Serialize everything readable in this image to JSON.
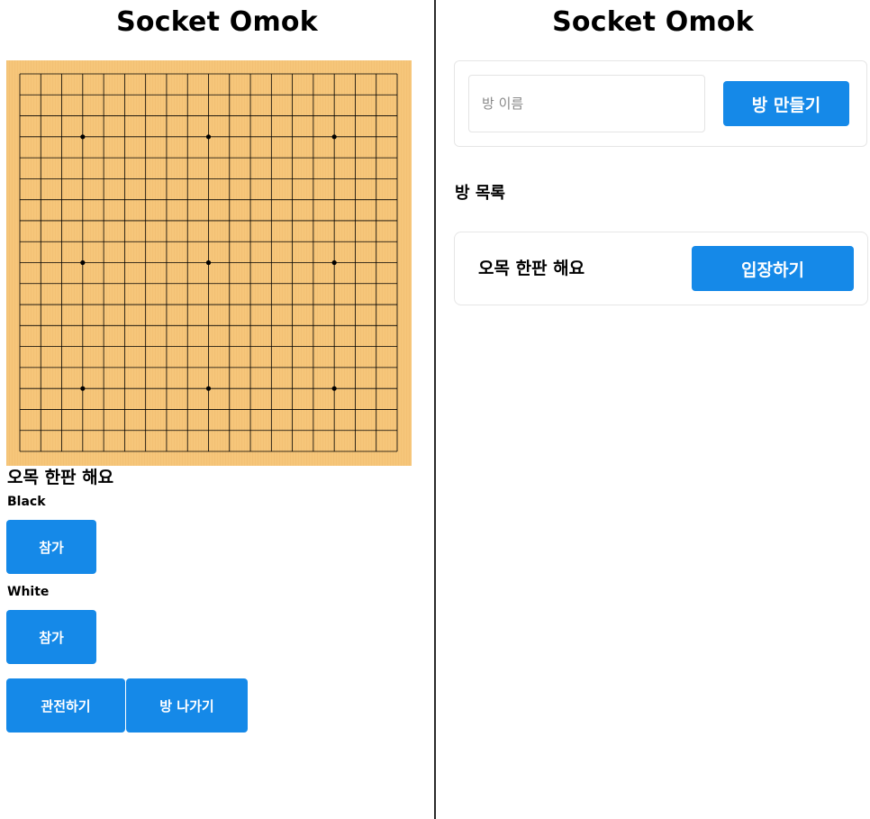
{
  "left": {
    "title": "Socket Omok",
    "room_name": "오목 한판 해요",
    "black_label": "Black",
    "black_join": "참가",
    "white_label": "White",
    "white_join": "참가",
    "spectate": "관전하기",
    "leave": "방 나가기",
    "board": {
      "lines": 19,
      "star_points": [
        [
          3,
          3
        ],
        [
          3,
          9
        ],
        [
          3,
          15
        ],
        [
          9,
          3
        ],
        [
          9,
          9
        ],
        [
          9,
          15
        ],
        [
          15,
          3
        ],
        [
          15,
          9
        ],
        [
          15,
          15
        ]
      ],
      "board_color": "#f6c67a",
      "line_color": "#000000"
    }
  },
  "right": {
    "title": "Socket Omok",
    "room_input_placeholder": "방 이름",
    "room_input_value": "",
    "create_button": "방 만들기",
    "list_title": "방 목록",
    "rooms": [
      {
        "name": "오목 한판 해요",
        "enter_label": "입장하기"
      }
    ]
  },
  "colors": {
    "accent": "#1589e8",
    "divider": "#2a2a2a"
  }
}
